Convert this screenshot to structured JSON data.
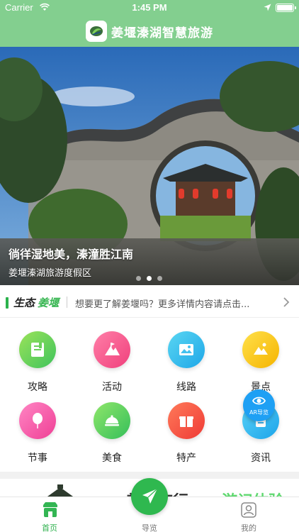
{
  "status_bar": {
    "carrier": "Carrier",
    "time": "1:45 PM"
  },
  "header": {
    "title": "姜堰溱湖智慧旅游"
  },
  "banner": {
    "title": "徜徉湿地美，溱潼胜江南",
    "subtitle": "姜堰溱湖旅游度假区",
    "dots": 3,
    "active_dot": 1
  },
  "news": {
    "label_part1": "生态",
    "label_part2": "姜堰",
    "text": "想要更了解姜堰吗？更多详情内容请点击..."
  },
  "grid": {
    "items": [
      {
        "label": "攻略",
        "icon": "guide-book-icon"
      },
      {
        "label": "活动",
        "icon": "activity-mountain-icon"
      },
      {
        "label": "线路",
        "icon": "route-map-icon"
      },
      {
        "label": "景点",
        "icon": "scenic-spot-icon"
      },
      {
        "label": "节事",
        "icon": "festival-balloon-icon"
      },
      {
        "label": "美食",
        "icon": "food-dish-icon"
      },
      {
        "label": "特产",
        "icon": "specialty-gift-icon"
      },
      {
        "label": "资讯",
        "icon": "news-info-icon"
      }
    ]
  },
  "ar_button": {
    "label": "AR导览"
  },
  "promo": {
    "text_main": "姜堰旅行",
    "text_accent": "游记体验"
  },
  "tabbar": {
    "tabs": [
      {
        "label": "首页",
        "active": true
      },
      {
        "label": "导览",
        "active": false
      },
      {
        "label": "我的",
        "active": false
      }
    ]
  },
  "colors": {
    "header_green": "#83cf8f",
    "accent_green": "#2fb14e",
    "ar_blue": "#1ea0f4"
  }
}
